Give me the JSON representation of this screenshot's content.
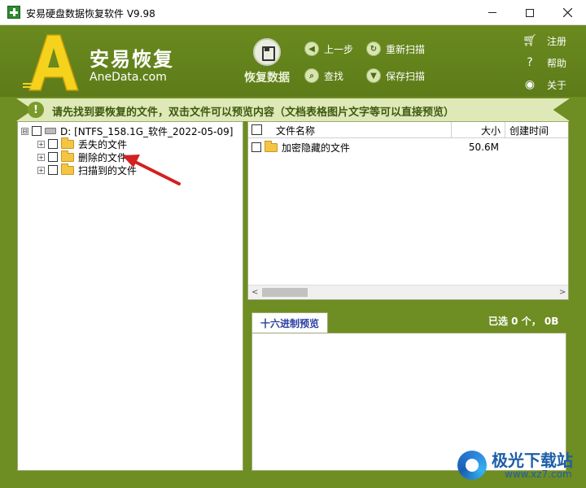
{
  "window": {
    "title": "安易硬盘数据恢复软件 V9.98",
    "minimize_icon": "minimize-icon",
    "maximize_icon": "maximize-icon",
    "close_icon": "close-icon"
  },
  "brand": {
    "logo_letter": "A",
    "name_cn": "安易恢复",
    "name_en": "AneData.com"
  },
  "toolbar": {
    "recover_label": "恢复数据",
    "prev_label": "上一步",
    "rescan_label": "重新扫描",
    "find_label": "查找",
    "save_scan_label": "保存扫描"
  },
  "side_links": {
    "register_label": "注册",
    "help_label": "帮助",
    "about_label": "关于"
  },
  "notice": {
    "icon_glyph": "!",
    "text": "请先找到要恢复的文件，双击文件可以预览内容（文档表格图片文字等可以直接预览）"
  },
  "tree": {
    "root": {
      "expander": "⊟",
      "label": "D:  [NTFS_158.1G_软件_2022-05-09]"
    },
    "items": [
      {
        "expander": "+",
        "label": "丢失的文件"
      },
      {
        "expander": "+",
        "label": "删除的文件"
      },
      {
        "expander": "+",
        "label": "扫描到的文件"
      }
    ]
  },
  "file_list": {
    "columns": {
      "name": "文件名称",
      "size": "大小",
      "created": "创建时间"
    },
    "rows": [
      {
        "name": "加密隐藏的文件",
        "size": "50.6M",
        "created": ""
      }
    ],
    "scroll_left_glyph": "<",
    "scroll_right_glyph": ">"
  },
  "preview": {
    "tab_label": "十六进制预览",
    "selected_info": "已选 0 个， 0B"
  },
  "watermark": {
    "cn": "极光下载站",
    "url": "www.xz7.com"
  },
  "colors": {
    "frame_green": "#6e8d22",
    "notice_bg": "#dfe9b8",
    "folder_yellow": "#f3c541",
    "arrow_red": "#d42020"
  }
}
